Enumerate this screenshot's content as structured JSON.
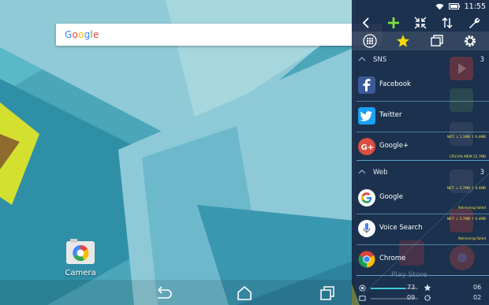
{
  "status_bar": {
    "time": "11:55"
  },
  "search": {
    "logo_letters": [
      "G",
      "o",
      "o",
      "g",
      "l",
      "e"
    ],
    "logo_colors": [
      "#4285f4",
      "#ea4335",
      "#fbbc05",
      "#4285f4",
      "#34a853",
      "#ea4335"
    ]
  },
  "home": {
    "camera_label": "Camera"
  },
  "panel": {
    "sections": [
      {
        "name": "SNS",
        "count": "3",
        "apps": [
          {
            "name": "Facebook",
            "icon": "facebook-icon",
            "color": "#3b5998"
          },
          {
            "name": "Twitter",
            "icon": "twitter-icon",
            "color": "#1da1f2"
          },
          {
            "name": "Google+",
            "icon": "google-plus-icon",
            "color": "#dc4e41",
            "stat_net": "NET: ↓ 1.1MB ↑ 0.4MB",
            "stat_cpu": "CPU:0% MEM:15.7MB"
          }
        ]
      },
      {
        "name": "Web",
        "count": "3",
        "apps": [
          {
            "name": "Google",
            "icon": "google-icon",
            "stat_net": "NET: ↓ 5.7MB ↑ 0.4MB",
            "stat_status": "Retrieving failed"
          },
          {
            "name": "Voice Search",
            "icon": "microphone-icon",
            "stat_net": "NET: ↓ 5.7MB ↑ 0.4MB",
            "stat_status": "Retrieving failed"
          },
          {
            "name": "Chrome",
            "icon": "chrome-icon"
          }
        ]
      }
    ],
    "background_label": "Play Store",
    "footer": {
      "brightness": "73",
      "volume": "09",
      "stars": "06",
      "settings": "02"
    }
  },
  "colors": {
    "panel_bg": "#182846",
    "accent_yellow": "#f5d90a",
    "stat_yellow": "#f3e04a"
  }
}
